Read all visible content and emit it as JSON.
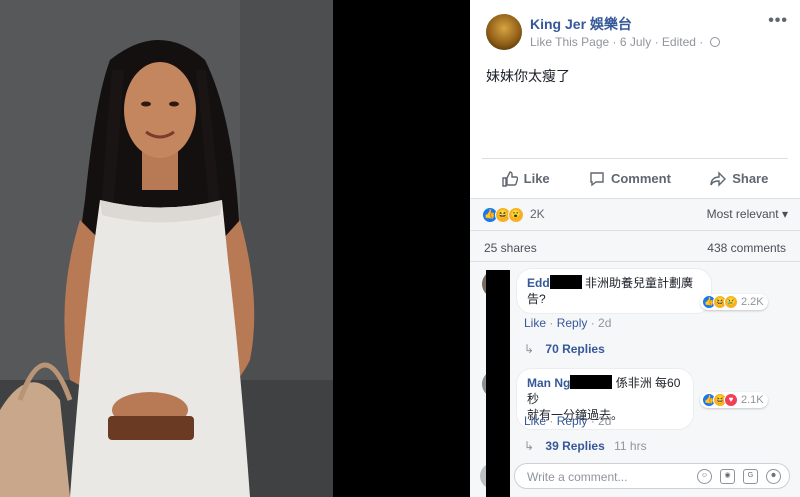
{
  "post": {
    "page_name": "King Jer 娛樂台",
    "like_page": "Like This Page",
    "dot": "·",
    "date": "6 July",
    "edited": "Edited",
    "text": "妹妹你太瘦了"
  },
  "actions": {
    "like": "Like",
    "comment": "Comment",
    "share": "Share"
  },
  "reactions": {
    "count": "2K",
    "sort": "Most relevant"
  },
  "stats": {
    "shares": "25 shares",
    "comments": "438 comments"
  },
  "comments": [
    {
      "name_prefix": "Edd",
      "text_line1": "非洲助養兒童計劃廣",
      "text_line2": "告?",
      "react_count": "2.2K",
      "like": "Like",
      "reply": "Reply",
      "age": "2d",
      "replies": "70 Replies"
    },
    {
      "name_prefix": "Man Ng",
      "text_line1": "係非洲 每60秒",
      "text_line2": "就有一分鐘過去。",
      "react_count": "2.1K",
      "like": "Like",
      "reply": "Reply",
      "age": "2d",
      "replies": "39 Replies",
      "replies_time": "11 hrs"
    }
  ],
  "composer": {
    "placeholder": "Write a comment..."
  },
  "colors": {
    "link": "#365899",
    "meta": "#90949c",
    "like_blue": "#1877f2",
    "love_red": "#f33e58",
    "emoji_yellow": "#f7b125"
  }
}
